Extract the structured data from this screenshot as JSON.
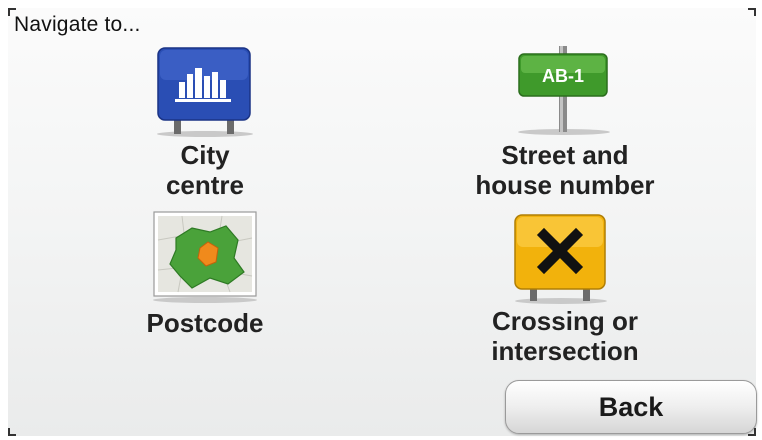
{
  "header": {
    "title": "Navigate to..."
  },
  "options": {
    "city": {
      "label": "City\ncentre",
      "icon": "city-centre-sign-icon"
    },
    "street": {
      "label": "Street and\nhouse number",
      "icon": "street-sign-icon",
      "sign_text": "AB-1"
    },
    "postcode": {
      "label": "Postcode",
      "icon": "postcode-map-icon"
    },
    "crossing": {
      "label": "Crossing or\nintersection",
      "icon": "crossing-sign-icon"
    }
  },
  "footer": {
    "back_label": "Back"
  },
  "colors": {
    "city_sign": "#2b4fb8",
    "street_sign": "#3e9a2a",
    "crossing_sign": "#f2b20c",
    "map_green": "#4aa23a",
    "map_orange": "#f08a1c"
  }
}
